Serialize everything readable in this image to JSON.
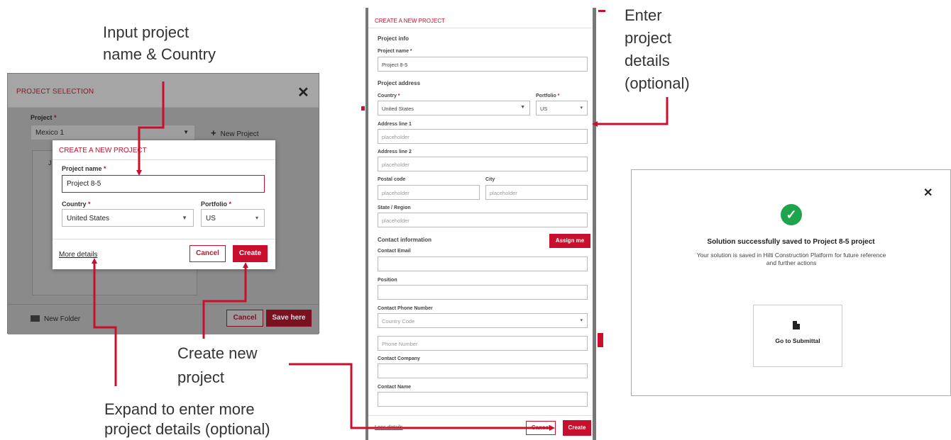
{
  "annotations": {
    "input_name_line1": "Input project",
    "input_name_line2": "name & Country",
    "enter_details_line1": "Enter",
    "enter_details_line2": "project",
    "enter_details_line3": "details",
    "enter_details_line4": "(optional)",
    "create_new_line1": "Create new",
    "create_new_line2": "project",
    "expand_line1": "Expand to enter more",
    "expand_line2": "project details (optional)"
  },
  "project_selection": {
    "title": "PROJECT SELECTION",
    "close_icon": "close-icon",
    "project_label": "Project",
    "required_mark": "*",
    "project_value": "Mexico 1",
    "new_project_label": "New Project",
    "tree_initial": "J",
    "new_folder_label": "New Folder",
    "cancel_label": "Cancel",
    "save_label": "Save here"
  },
  "create_modal": {
    "title": "CREATE A NEW PROJECT",
    "project_name_label": "Project name",
    "project_name_value": "Project 8-5",
    "country_label": "Country",
    "country_value": "United States",
    "portfolio_label": "Portfolio",
    "portfolio_value": "US",
    "more_details_label": "More details",
    "cancel_label": "Cancel",
    "create_label": "Create"
  },
  "full_form": {
    "title": "CREATE A NEW PROJECT",
    "project_info": "Project info",
    "project_name_label": "Project name",
    "project_name_value": "Project 8-5",
    "project_address": "Project address",
    "country_label": "Country",
    "country_value": "United States",
    "portfolio_label": "Portfolio",
    "portfolio_value": "US",
    "address1_label": "Address line 1",
    "address2_label": "Address line 2",
    "placeholder": "placeholder",
    "postal_label": "Postal code",
    "city_label": "City",
    "state_label": "State / Region",
    "contact_info": "Contact information",
    "assign_me": "Assign me",
    "contact_email_label": "Contact Email",
    "position_label": "Position",
    "phone_label": "Contact Phone Number",
    "country_code_placeholder": "Country Code",
    "phone_placeholder": "Phone Number",
    "company_label": "Contact Company",
    "name_label": "Contact Name",
    "less_details": "Less details",
    "cancel_label": "Cancel",
    "create_label": "Create"
  },
  "success": {
    "heading": "Solution successfully saved to Project 8-5 project",
    "message": "Your solution is saved in Hilti Construction Platform for future reference and further actions",
    "go_label": "Go to Submittal",
    "check_icon": "check-circle-icon",
    "doc_icon": "document-icon"
  },
  "colors": {
    "accent": "#c8102e",
    "success": "#1ea44c",
    "arrow": "#c8102e"
  }
}
